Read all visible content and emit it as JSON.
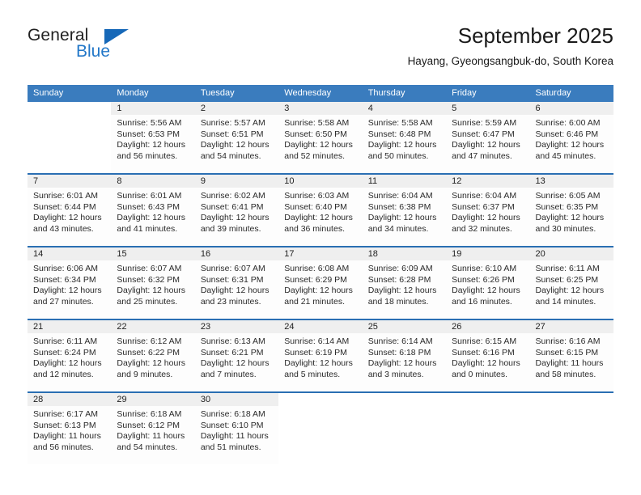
{
  "brand": {
    "name_part1": "General",
    "name_part2": "Blue",
    "accent_color": "#1668b8"
  },
  "header": {
    "month_title": "September 2025",
    "location": "Hayang, Gyeongsangbuk-do, South Korea"
  },
  "calendar": {
    "header_bg": "#3a7cbe",
    "weekdays": [
      "Sunday",
      "Monday",
      "Tuesday",
      "Wednesday",
      "Thursday",
      "Friday",
      "Saturday"
    ],
    "weeks": [
      [
        {
          "day": "",
          "lines": []
        },
        {
          "day": "1",
          "lines": [
            "Sunrise: 5:56 AM",
            "Sunset: 6:53 PM",
            "Daylight: 12 hours",
            "and 56 minutes."
          ]
        },
        {
          "day": "2",
          "lines": [
            "Sunrise: 5:57 AM",
            "Sunset: 6:51 PM",
            "Daylight: 12 hours",
            "and 54 minutes."
          ]
        },
        {
          "day": "3",
          "lines": [
            "Sunrise: 5:58 AM",
            "Sunset: 6:50 PM",
            "Daylight: 12 hours",
            "and 52 minutes."
          ]
        },
        {
          "day": "4",
          "lines": [
            "Sunrise: 5:58 AM",
            "Sunset: 6:48 PM",
            "Daylight: 12 hours",
            "and 50 minutes."
          ]
        },
        {
          "day": "5",
          "lines": [
            "Sunrise: 5:59 AM",
            "Sunset: 6:47 PM",
            "Daylight: 12 hours",
            "and 47 minutes."
          ]
        },
        {
          "day": "6",
          "lines": [
            "Sunrise: 6:00 AM",
            "Sunset: 6:46 PM",
            "Daylight: 12 hours",
            "and 45 minutes."
          ]
        }
      ],
      [
        {
          "day": "7",
          "lines": [
            "Sunrise: 6:01 AM",
            "Sunset: 6:44 PM",
            "Daylight: 12 hours",
            "and 43 minutes."
          ]
        },
        {
          "day": "8",
          "lines": [
            "Sunrise: 6:01 AM",
            "Sunset: 6:43 PM",
            "Daylight: 12 hours",
            "and 41 minutes."
          ]
        },
        {
          "day": "9",
          "lines": [
            "Sunrise: 6:02 AM",
            "Sunset: 6:41 PM",
            "Daylight: 12 hours",
            "and 39 minutes."
          ]
        },
        {
          "day": "10",
          "lines": [
            "Sunrise: 6:03 AM",
            "Sunset: 6:40 PM",
            "Daylight: 12 hours",
            "and 36 minutes."
          ]
        },
        {
          "day": "11",
          "lines": [
            "Sunrise: 6:04 AM",
            "Sunset: 6:38 PM",
            "Daylight: 12 hours",
            "and 34 minutes."
          ]
        },
        {
          "day": "12",
          "lines": [
            "Sunrise: 6:04 AM",
            "Sunset: 6:37 PM",
            "Daylight: 12 hours",
            "and 32 minutes."
          ]
        },
        {
          "day": "13",
          "lines": [
            "Sunrise: 6:05 AM",
            "Sunset: 6:35 PM",
            "Daylight: 12 hours",
            "and 30 minutes."
          ]
        }
      ],
      [
        {
          "day": "14",
          "lines": [
            "Sunrise: 6:06 AM",
            "Sunset: 6:34 PM",
            "Daylight: 12 hours",
            "and 27 minutes."
          ]
        },
        {
          "day": "15",
          "lines": [
            "Sunrise: 6:07 AM",
            "Sunset: 6:32 PM",
            "Daylight: 12 hours",
            "and 25 minutes."
          ]
        },
        {
          "day": "16",
          "lines": [
            "Sunrise: 6:07 AM",
            "Sunset: 6:31 PM",
            "Daylight: 12 hours",
            "and 23 minutes."
          ]
        },
        {
          "day": "17",
          "lines": [
            "Sunrise: 6:08 AM",
            "Sunset: 6:29 PM",
            "Daylight: 12 hours",
            "and 21 minutes."
          ]
        },
        {
          "day": "18",
          "lines": [
            "Sunrise: 6:09 AM",
            "Sunset: 6:28 PM",
            "Daylight: 12 hours",
            "and 18 minutes."
          ]
        },
        {
          "day": "19",
          "lines": [
            "Sunrise: 6:10 AM",
            "Sunset: 6:26 PM",
            "Daylight: 12 hours",
            "and 16 minutes."
          ]
        },
        {
          "day": "20",
          "lines": [
            "Sunrise: 6:11 AM",
            "Sunset: 6:25 PM",
            "Daylight: 12 hours",
            "and 14 minutes."
          ]
        }
      ],
      [
        {
          "day": "21",
          "lines": [
            "Sunrise: 6:11 AM",
            "Sunset: 6:24 PM",
            "Daylight: 12 hours",
            "and 12 minutes."
          ]
        },
        {
          "day": "22",
          "lines": [
            "Sunrise: 6:12 AM",
            "Sunset: 6:22 PM",
            "Daylight: 12 hours",
            "and 9 minutes."
          ]
        },
        {
          "day": "23",
          "lines": [
            "Sunrise: 6:13 AM",
            "Sunset: 6:21 PM",
            "Daylight: 12 hours",
            "and 7 minutes."
          ]
        },
        {
          "day": "24",
          "lines": [
            "Sunrise: 6:14 AM",
            "Sunset: 6:19 PM",
            "Daylight: 12 hours",
            "and 5 minutes."
          ]
        },
        {
          "day": "25",
          "lines": [
            "Sunrise: 6:14 AM",
            "Sunset: 6:18 PM",
            "Daylight: 12 hours",
            "and 3 minutes."
          ]
        },
        {
          "day": "26",
          "lines": [
            "Sunrise: 6:15 AM",
            "Sunset: 6:16 PM",
            "Daylight: 12 hours",
            "and 0 minutes."
          ]
        },
        {
          "day": "27",
          "lines": [
            "Sunrise: 6:16 AM",
            "Sunset: 6:15 PM",
            "Daylight: 11 hours",
            "and 58 minutes."
          ]
        }
      ],
      [
        {
          "day": "28",
          "lines": [
            "Sunrise: 6:17 AM",
            "Sunset: 6:13 PM",
            "Daylight: 11 hours",
            "and 56 minutes."
          ]
        },
        {
          "day": "29",
          "lines": [
            "Sunrise: 6:18 AM",
            "Sunset: 6:12 PM",
            "Daylight: 11 hours",
            "and 54 minutes."
          ]
        },
        {
          "day": "30",
          "lines": [
            "Sunrise: 6:18 AM",
            "Sunset: 6:10 PM",
            "Daylight: 11 hours",
            "and 51 minutes."
          ]
        },
        {
          "day": "",
          "lines": []
        },
        {
          "day": "",
          "lines": []
        },
        {
          "day": "",
          "lines": []
        },
        {
          "day": "",
          "lines": []
        }
      ]
    ]
  }
}
